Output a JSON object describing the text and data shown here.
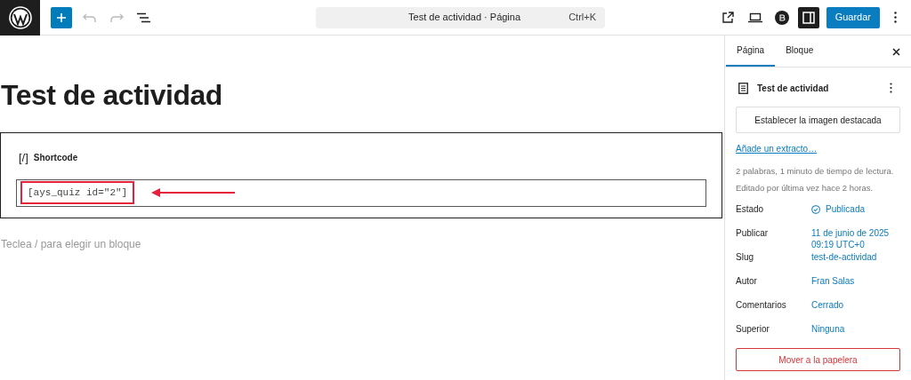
{
  "toolbar": {
    "command_bar": {
      "title": "Test de actividad · Página",
      "shortcut": "Ctrl+K"
    },
    "sidebar_toggle": {
      "on": true
    },
    "save_button": "Guardar"
  },
  "editor": {
    "title": "Test de actividad",
    "block": {
      "label": "Shortcode",
      "icon_text": "[/]",
      "value": "[ays_quiz id=\"2\"]",
      "highlighted": true
    },
    "placeholder": "Teclea / para elegir un bloque"
  },
  "sidebar": {
    "tabs": [
      {
        "label": "Página",
        "selected": true
      },
      {
        "label": "Bloque",
        "selected": false
      }
    ],
    "page_title": "Test de actividad",
    "featured_image_button": "Establecer la imagen destacada",
    "excerpt_link": "Añade un extracto…",
    "stats": [
      "2 palabras, 1 minuto de tiempo de lectura.",
      "Editado por última vez hace 2 horas."
    ],
    "fields": [
      {
        "label": "Estado",
        "value": "Publicada",
        "kind": "status"
      },
      {
        "label": "Publicar",
        "value": "11 de junio de 2025 09:19 UTC+0",
        "kind": "text"
      },
      {
        "label": "Slug",
        "value": "test-de-actividad",
        "kind": "text"
      },
      {
        "label": "Autor",
        "value": "Fran Salas",
        "kind": "text"
      },
      {
        "label": "Comentarios",
        "value": "Cerrado",
        "kind": "text"
      },
      {
        "label": "Superior",
        "value": "Ninguna",
        "kind": "text"
      }
    ],
    "trash_button": "Mover a la papelera"
  }
}
